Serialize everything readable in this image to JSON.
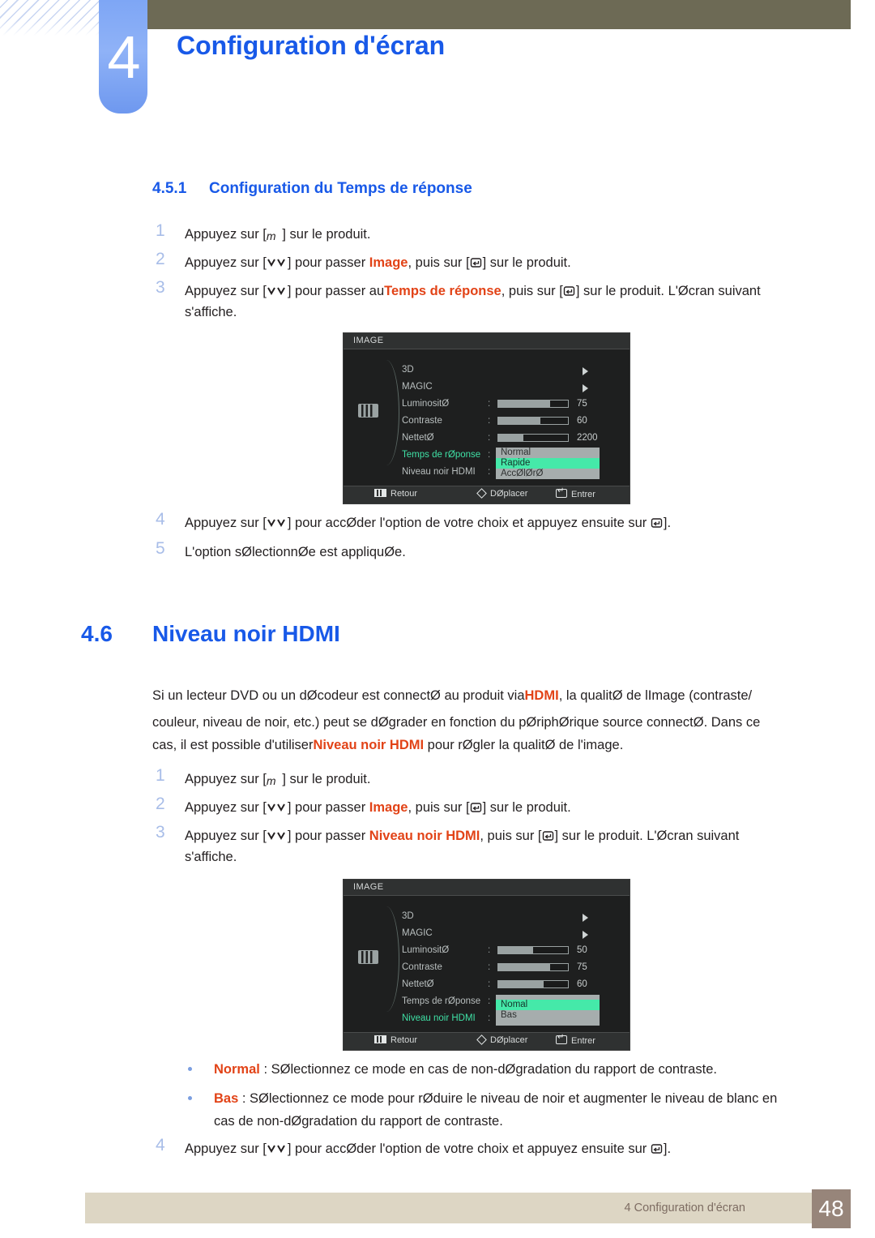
{
  "header": {
    "chapter_number": "4",
    "chapter_title": "Configuration d'écran"
  },
  "section_451": {
    "number": "4.5.1",
    "title": "Configuration du Temps de réponse",
    "steps": [
      {
        "n": "1",
        "pre": "Appuyez sur [",
        "key": "m",
        "post": "] sur le produit.",
        "type": "menu-key"
      },
      {
        "n": "2",
        "pre": "Appuyez sur [",
        "key": "updown",
        "mid": "] pour passer  ",
        "highlight": "Image",
        "mid2": ", puis sur [",
        "key2": "enter",
        "post": "] sur le produit.",
        "type": "nav"
      },
      {
        "n": "3",
        "pre": "Appuyez sur [",
        "key": "updown",
        "mid": "] pour passer au",
        "highlight": "Temps de réponse",
        "mid2": ", puis sur [",
        "key2": "enter",
        "post": "] sur le produit. L'Øcran suivant",
        "cont": "s'affiche.",
        "type": "nav"
      }
    ],
    "steps_after": [
      {
        "n": "4",
        "pre": "Appuyez sur [",
        "key": "updown",
        "mid": "] pour accØder l'option de votre choix et appuyez ensuite sur ",
        "key2": "enter",
        "post": "]."
      },
      {
        "n": "5",
        "text": "L'option sØlectionnØe est appliquØe."
      }
    ]
  },
  "section_46": {
    "number": "4.6",
    "title": "Niveau noir HDMI",
    "paragraph_lines": [
      {
        "a": "Si un lecteur DVD ou un dØcodeur est connectØ au produit via",
        "hl": "HDMI",
        "b": ", la qualitØ de lImage (contraste/"
      },
      {
        "a": "couleur, niveau de noir, etc.) peut se dØgrader en fonction du pØriphØrique source connectØ. Dans ce"
      },
      {
        "a": "cas, il est possible d'utiliser",
        "hl": "Niveau noir HDMI",
        "b": " pour rØgler la qualitØ de l'image."
      }
    ],
    "steps": [
      {
        "n": "1",
        "pre": "Appuyez sur [",
        "key": "m",
        "post": "] sur le produit.",
        "type": "menu-key"
      },
      {
        "n": "2",
        "pre": "Appuyez sur [",
        "key": "updown",
        "mid": "] pour passer  ",
        "highlight": "Image",
        "mid2": ", puis sur [",
        "key2": "enter",
        "post": "] sur le produit.",
        "type": "nav"
      },
      {
        "n": "3",
        "pre": "Appuyez sur [",
        "key": "updown",
        "mid": "] pour passer  ",
        "highlight": "Niveau noir HDMI",
        "mid2": ", puis sur [",
        "key2": "enter",
        "post": "] sur le produit. L'Øcran suivant",
        "cont": "s'affiche.",
        "type": "nav"
      }
    ],
    "bullets": [
      {
        "label": "Normal",
        "text": " : SØlectionnez ce mode en cas de non-dØgradation du rapport de contraste."
      },
      {
        "label": "Bas",
        "text": " : SØlectionnez ce mode pour rØduire le niveau de noir et augmenter le niveau de blanc en",
        "cont": "cas de non-dØgradation du rapport de contraste."
      }
    ],
    "step_last": {
      "n": "4",
      "pre": "Appuyez sur [",
      "key": "updown",
      "mid": "] pour accØder l'option de votre choix et appuyez ensuite sur ",
      "key2": "enter",
      "post": "]."
    }
  },
  "osd1": {
    "title": "IMAGE",
    "rows": [
      {
        "label": "3D",
        "kind": "arrow"
      },
      {
        "label": "MAGIC",
        "kind": "arrow"
      },
      {
        "label": "LuminositØ",
        "kind": "slider",
        "fill": 74,
        "value": "75"
      },
      {
        "label": "Contraste",
        "kind": "slider",
        "fill": 60,
        "value": "60"
      },
      {
        "label": "NettetØ",
        "kind": "slider",
        "fill": 36,
        "value": "2200"
      },
      {
        "label": "Temps de rØponse",
        "kind": "dropdown",
        "active": true
      },
      {
        "label": "Niveau noir HDMI",
        "kind": "none"
      }
    ],
    "dropdown": {
      "options": [
        "Normal",
        "Rapide",
        "AccØlØrØ"
      ],
      "selected_index": 1
    },
    "footer": {
      "back": "Retour",
      "move": "DØplacer",
      "enter": "Entrer"
    }
  },
  "osd2": {
    "title": "IMAGE",
    "rows": [
      {
        "label": "3D",
        "kind": "arrow"
      },
      {
        "label": "MAGIC",
        "kind": "arrow"
      },
      {
        "label": "LuminositØ",
        "kind": "slider",
        "fill": 50,
        "value": "50"
      },
      {
        "label": "Contraste",
        "kind": "slider",
        "fill": 74,
        "value": "75"
      },
      {
        "label": "NettetØ",
        "kind": "slider",
        "fill": 65,
        "value": "60"
      },
      {
        "label": "Temps de rØponse",
        "kind": "none"
      },
      {
        "label": "Niveau noir HDMI",
        "kind": "dropdown",
        "active": true
      }
    ],
    "dropdown": {
      "options": [
        "Nomal",
        "Bas"
      ],
      "selected_index": 0
    },
    "footer": {
      "back": "Retour",
      "move": "DØplacer",
      "enter": "Entrer"
    }
  },
  "footer": {
    "text": "4 Configuration d'écran",
    "page": "48"
  },
  "colors": {
    "accent_blue": "#1859e8",
    "orange": "#e24317",
    "header_bar": "#6d6a55",
    "footer_bar": "#ddd6c4",
    "page_box": "#97857a",
    "osd_green": "#45e9a9"
  }
}
